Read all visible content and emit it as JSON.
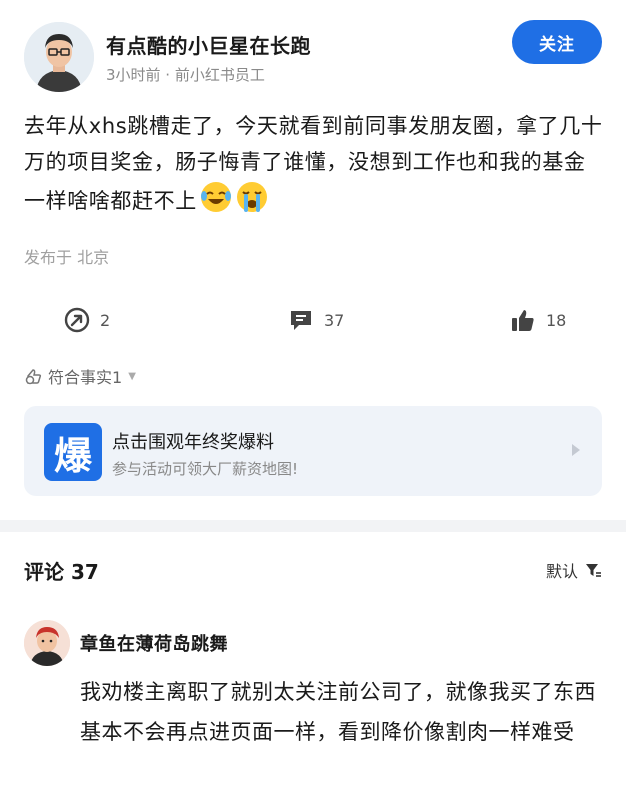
{
  "author": {
    "name": "有点酷的小巨星在长跑",
    "meta": "3小时前 · 前小红书员工",
    "follow_label": "关注"
  },
  "post": {
    "text": "去年从xhs跳槽走了，今天就看到前同事发朋友圈，拿了几十万的项目奖金，肠子悔青了谁懂，没想到工作也和我的基金一样啥啥都赶不上",
    "emojis": [
      "laugh-cry-emoji",
      "crying-emoji"
    ],
    "location": "发布于 北京"
  },
  "actions": {
    "share_count": "2",
    "comment_count": "37",
    "like_count": "18"
  },
  "fact_check": {
    "label": "符合事实1"
  },
  "promo": {
    "logo_char": "爆",
    "title": "点击围观年终奖爆料",
    "subtitle": "参与活动可领大厂薪资地图!"
  },
  "comments": {
    "title": "评论 37",
    "sort_label": "默认",
    "items": [
      {
        "name": "章鱼在薄荷岛跳舞",
        "text": "我劝楼主离职了就别太关注前公司了，就像我买了东西基本不会再点进页面一样，看到降价像割肉一样难受"
      }
    ]
  },
  "colors": {
    "accent": "#1f6fe5",
    "muted": "#8a8a8a",
    "card_bg": "#eff3f9"
  }
}
